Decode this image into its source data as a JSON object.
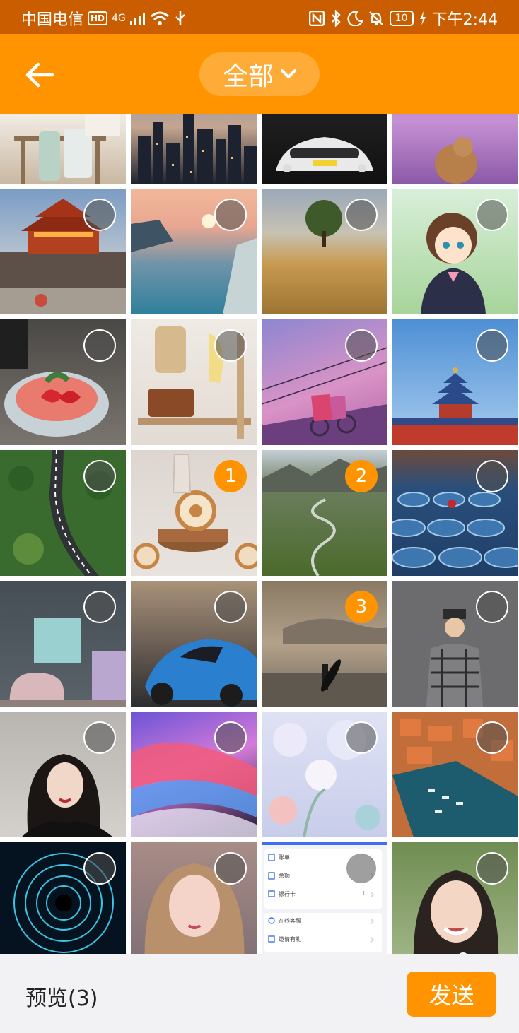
{
  "status_bar": {
    "carrier": "中国电信",
    "hd": "HD",
    "signal": "4G",
    "battery": "10",
    "time": "下午2:44"
  },
  "header": {
    "album_label": "全部",
    "back_icon": "arrow-left-icon",
    "dropdown_icon": "chevron-down-icon"
  },
  "grid": {
    "cells": [
      {
        "id": "kitchen",
        "sel": ""
      },
      {
        "id": "city",
        "sel": ""
      },
      {
        "id": "car",
        "sel": ""
      },
      {
        "id": "lavender",
        "sel": ""
      },
      {
        "id": "tower",
        "sel": ""
      },
      {
        "id": "sunset",
        "sel": ""
      },
      {
        "id": "field",
        "sel": ""
      },
      {
        "id": "anime",
        "sel": ""
      },
      {
        "id": "dessert",
        "sel": ""
      },
      {
        "id": "interior",
        "sel": ""
      },
      {
        "id": "couple",
        "sel": ""
      },
      {
        "id": "temple",
        "sel": ""
      },
      {
        "id": "road",
        "sel": ""
      },
      {
        "id": "cake",
        "sel": "1"
      },
      {
        "id": "valley",
        "sel": "2"
      },
      {
        "id": "tiles",
        "sel": ""
      },
      {
        "id": "room",
        "sel": ""
      },
      {
        "id": "bluecar",
        "sel": ""
      },
      {
        "id": "surfer",
        "sel": "3"
      },
      {
        "id": "model",
        "sel": ""
      },
      {
        "id": "portrait",
        "sel": ""
      },
      {
        "id": "waves",
        "sel": ""
      },
      {
        "id": "flowers",
        "sel": ""
      },
      {
        "id": "harbor",
        "sel": ""
      },
      {
        "id": "spiral",
        "sel": ""
      },
      {
        "id": "girl",
        "sel": ""
      },
      {
        "id": "screenshot",
        "sel": ""
      },
      {
        "id": "smile",
        "sel": ""
      }
    ]
  },
  "screenshot_thumb": {
    "rows": [
      "账单",
      "余额",
      "银行卡",
      "在线客服",
      "邀请有礼"
    ],
    "count": "1"
  },
  "footer": {
    "preview_label": "预览(3)",
    "send_label": "发送"
  },
  "colors": {
    "accent": "#ff9400",
    "status_bar": "#c95d00"
  }
}
